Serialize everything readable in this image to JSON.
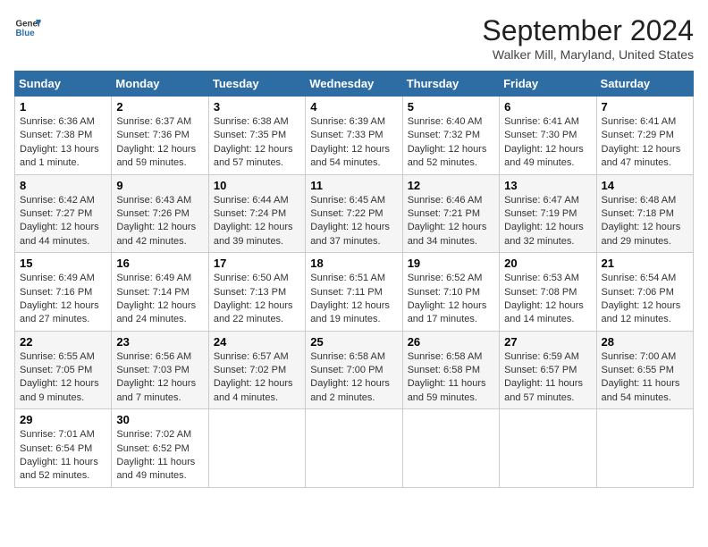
{
  "header": {
    "logo_line1": "General",
    "logo_line2": "Blue",
    "month": "September 2024",
    "location": "Walker Mill, Maryland, United States"
  },
  "days_of_week": [
    "Sunday",
    "Monday",
    "Tuesday",
    "Wednesday",
    "Thursday",
    "Friday",
    "Saturday"
  ],
  "weeks": [
    [
      {
        "day": "1",
        "info": "Sunrise: 6:36 AM\nSunset: 7:38 PM\nDaylight: 13 hours\nand 1 minute."
      },
      {
        "day": "2",
        "info": "Sunrise: 6:37 AM\nSunset: 7:36 PM\nDaylight: 12 hours\nand 59 minutes."
      },
      {
        "day": "3",
        "info": "Sunrise: 6:38 AM\nSunset: 7:35 PM\nDaylight: 12 hours\nand 57 minutes."
      },
      {
        "day": "4",
        "info": "Sunrise: 6:39 AM\nSunset: 7:33 PM\nDaylight: 12 hours\nand 54 minutes."
      },
      {
        "day": "5",
        "info": "Sunrise: 6:40 AM\nSunset: 7:32 PM\nDaylight: 12 hours\nand 52 minutes."
      },
      {
        "day": "6",
        "info": "Sunrise: 6:41 AM\nSunset: 7:30 PM\nDaylight: 12 hours\nand 49 minutes."
      },
      {
        "day": "7",
        "info": "Sunrise: 6:41 AM\nSunset: 7:29 PM\nDaylight: 12 hours\nand 47 minutes."
      }
    ],
    [
      {
        "day": "8",
        "info": "Sunrise: 6:42 AM\nSunset: 7:27 PM\nDaylight: 12 hours\nand 44 minutes."
      },
      {
        "day": "9",
        "info": "Sunrise: 6:43 AM\nSunset: 7:26 PM\nDaylight: 12 hours\nand 42 minutes."
      },
      {
        "day": "10",
        "info": "Sunrise: 6:44 AM\nSunset: 7:24 PM\nDaylight: 12 hours\nand 39 minutes."
      },
      {
        "day": "11",
        "info": "Sunrise: 6:45 AM\nSunset: 7:22 PM\nDaylight: 12 hours\nand 37 minutes."
      },
      {
        "day": "12",
        "info": "Sunrise: 6:46 AM\nSunset: 7:21 PM\nDaylight: 12 hours\nand 34 minutes."
      },
      {
        "day": "13",
        "info": "Sunrise: 6:47 AM\nSunset: 7:19 PM\nDaylight: 12 hours\nand 32 minutes."
      },
      {
        "day": "14",
        "info": "Sunrise: 6:48 AM\nSunset: 7:18 PM\nDaylight: 12 hours\nand 29 minutes."
      }
    ],
    [
      {
        "day": "15",
        "info": "Sunrise: 6:49 AM\nSunset: 7:16 PM\nDaylight: 12 hours\nand 27 minutes."
      },
      {
        "day": "16",
        "info": "Sunrise: 6:49 AM\nSunset: 7:14 PM\nDaylight: 12 hours\nand 24 minutes."
      },
      {
        "day": "17",
        "info": "Sunrise: 6:50 AM\nSunset: 7:13 PM\nDaylight: 12 hours\nand 22 minutes."
      },
      {
        "day": "18",
        "info": "Sunrise: 6:51 AM\nSunset: 7:11 PM\nDaylight: 12 hours\nand 19 minutes."
      },
      {
        "day": "19",
        "info": "Sunrise: 6:52 AM\nSunset: 7:10 PM\nDaylight: 12 hours\nand 17 minutes."
      },
      {
        "day": "20",
        "info": "Sunrise: 6:53 AM\nSunset: 7:08 PM\nDaylight: 12 hours\nand 14 minutes."
      },
      {
        "day": "21",
        "info": "Sunrise: 6:54 AM\nSunset: 7:06 PM\nDaylight: 12 hours\nand 12 minutes."
      }
    ],
    [
      {
        "day": "22",
        "info": "Sunrise: 6:55 AM\nSunset: 7:05 PM\nDaylight: 12 hours\nand 9 minutes."
      },
      {
        "day": "23",
        "info": "Sunrise: 6:56 AM\nSunset: 7:03 PM\nDaylight: 12 hours\nand 7 minutes."
      },
      {
        "day": "24",
        "info": "Sunrise: 6:57 AM\nSunset: 7:02 PM\nDaylight: 12 hours\nand 4 minutes."
      },
      {
        "day": "25",
        "info": "Sunrise: 6:58 AM\nSunset: 7:00 PM\nDaylight: 12 hours\nand 2 minutes."
      },
      {
        "day": "26",
        "info": "Sunrise: 6:58 AM\nSunset: 6:58 PM\nDaylight: 11 hours\nand 59 minutes."
      },
      {
        "day": "27",
        "info": "Sunrise: 6:59 AM\nSunset: 6:57 PM\nDaylight: 11 hours\nand 57 minutes."
      },
      {
        "day": "28",
        "info": "Sunrise: 7:00 AM\nSunset: 6:55 PM\nDaylight: 11 hours\nand 54 minutes."
      }
    ],
    [
      {
        "day": "29",
        "info": "Sunrise: 7:01 AM\nSunset: 6:54 PM\nDaylight: 11 hours\nand 52 minutes."
      },
      {
        "day": "30",
        "info": "Sunrise: 7:02 AM\nSunset: 6:52 PM\nDaylight: 11 hours\nand 49 minutes."
      },
      {
        "day": "",
        "info": ""
      },
      {
        "day": "",
        "info": ""
      },
      {
        "day": "",
        "info": ""
      },
      {
        "day": "",
        "info": ""
      },
      {
        "day": "",
        "info": ""
      }
    ]
  ]
}
